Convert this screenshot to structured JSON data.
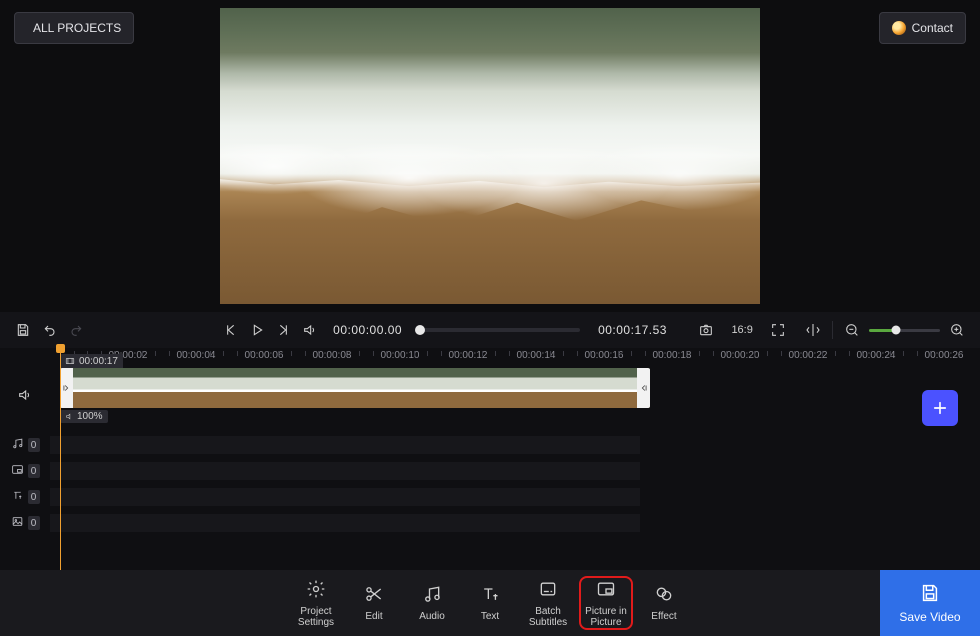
{
  "header": {
    "all_projects": "ALL PROJECTS",
    "contact": "Contact"
  },
  "transport": {
    "current_time": "00:00:00.00",
    "total_time": "00:00:17.53",
    "aspect_ratio": "16:9"
  },
  "timeline": {
    "ruler": [
      "00:00:02",
      "00:00:04",
      "00:00:06",
      "00:00:08",
      "00:00:10",
      "00:00:12",
      "00:00:14",
      "00:00:16",
      "00:00:18",
      "00:00:20",
      "00:00:22",
      "00:00:24",
      "00:00:26"
    ],
    "clip_duration_label": "00:00:17",
    "clip_volume": "100%",
    "tracks": {
      "music_count": "0",
      "pip_count": "0",
      "text_count": "0",
      "image_count": "0"
    }
  },
  "tools": [
    {
      "id": "project-settings",
      "label": "Project\nSettings",
      "icon": "gear"
    },
    {
      "id": "edit",
      "label": "Edit",
      "icon": "scissors"
    },
    {
      "id": "audio",
      "label": "Audio",
      "icon": "music"
    },
    {
      "id": "text",
      "label": "Text",
      "icon": "text"
    },
    {
      "id": "batch-subtitles",
      "label": "Batch\nSubtitles",
      "icon": "subtitles"
    },
    {
      "id": "picture-in-picture",
      "label": "Picture in\nPicture",
      "icon": "pip",
      "highlighted": true
    },
    {
      "id": "effect",
      "label": "Effect",
      "icon": "effect"
    }
  ],
  "save": {
    "label": "Save Video"
  }
}
